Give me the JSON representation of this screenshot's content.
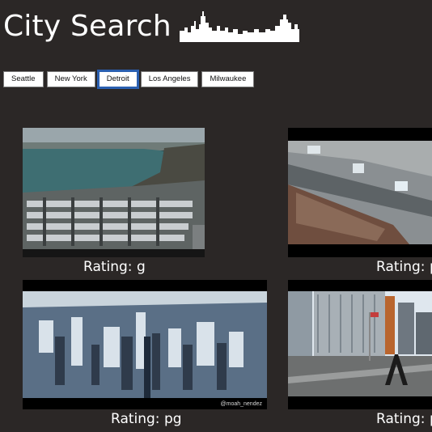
{
  "header": {
    "title": "City Search",
    "skyline_icon": "city-skyline-icon"
  },
  "tabs": [
    {
      "label": "Seattle",
      "active": false
    },
    {
      "label": "New York",
      "active": false
    },
    {
      "label": "Detroit",
      "active": true
    },
    {
      "label": "Los Angeles",
      "active": false
    },
    {
      "label": "Milwaukee",
      "active": false
    }
  ],
  "results": [
    {
      "rating": "Rating: g",
      "scene": "river-aerial-parking-lot"
    },
    {
      "rating": "Rating: pg",
      "scene": "rooftop-overhead"
    },
    {
      "rating": "Rating: pg",
      "scene": "downtown-aerial",
      "watermark": "@moah_nendez"
    },
    {
      "rating": "Rating: pg",
      "scene": "plaza-street"
    }
  ],
  "colors": {
    "background": "#2b2726",
    "active_tab_outline": "#2a5fb0"
  }
}
